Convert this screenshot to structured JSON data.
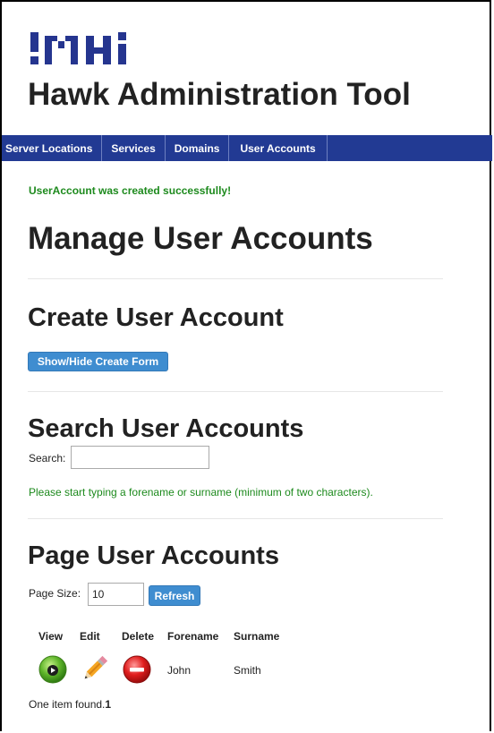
{
  "app": {
    "title": "Hawk Administration Tool"
  },
  "nav": {
    "items": [
      {
        "label": "Server Locations"
      },
      {
        "label": "Services"
      },
      {
        "label": "Domains"
      },
      {
        "label": "User Accounts"
      }
    ]
  },
  "flash": "UserAccount was created successfully!",
  "page_title": "Manage User Accounts",
  "create": {
    "heading": "Create User Account",
    "toggle_label": "Show/Hide Create Form"
  },
  "search": {
    "heading": "Search User Accounts",
    "label": "Search:",
    "value": "",
    "hint": "Please start typing a forename or surname (minimum of two characters)."
  },
  "paging": {
    "heading": "Page User Accounts",
    "size_label": "Page Size:",
    "size_value": "10",
    "refresh_label": "Refresh"
  },
  "table": {
    "headers": {
      "view": "View",
      "edit": "Edit",
      "delete": "Delete",
      "forename": "Forename",
      "surname": "Surname"
    },
    "rows": [
      {
        "forename": "John",
        "surname": "Smith"
      }
    ]
  },
  "result": {
    "text": "One item found.",
    "page": "1"
  },
  "colors": {
    "brand": "#25358f",
    "navbar": "#223a93",
    "success": "#1d8a1d",
    "button": "#3f8dd0"
  }
}
